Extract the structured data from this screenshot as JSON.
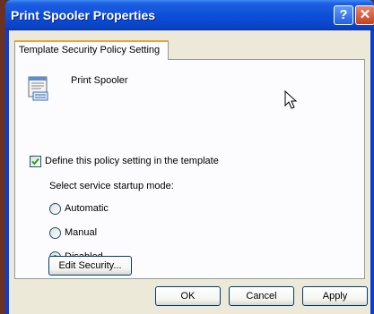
{
  "window": {
    "title": "Print Spooler Properties",
    "help_glyph": "?",
    "close_glyph": "✕"
  },
  "tab": {
    "label": "Template Security Policy Setting"
  },
  "service": {
    "name": "Print Spooler",
    "icon": "service-document-icon"
  },
  "policy": {
    "define_label": "Define this policy setting in the template",
    "define_checked": true
  },
  "startup": {
    "label": "Select service startup mode:",
    "options": [
      {
        "label": "Automatic",
        "selected": false
      },
      {
        "label": "Manual",
        "selected": false
      },
      {
        "label": "Disabled",
        "selected": true
      }
    ]
  },
  "buttons": {
    "edit_security": "Edit Security...",
    "ok": "OK",
    "cancel": "Cancel",
    "apply": "Apply"
  },
  "colors": {
    "titlebar": "#0a44c9",
    "client_bg": "#ece9d8",
    "tab_accent": "#f0a030",
    "radio_dot": "#21a121",
    "check_mark": "#21a121"
  }
}
